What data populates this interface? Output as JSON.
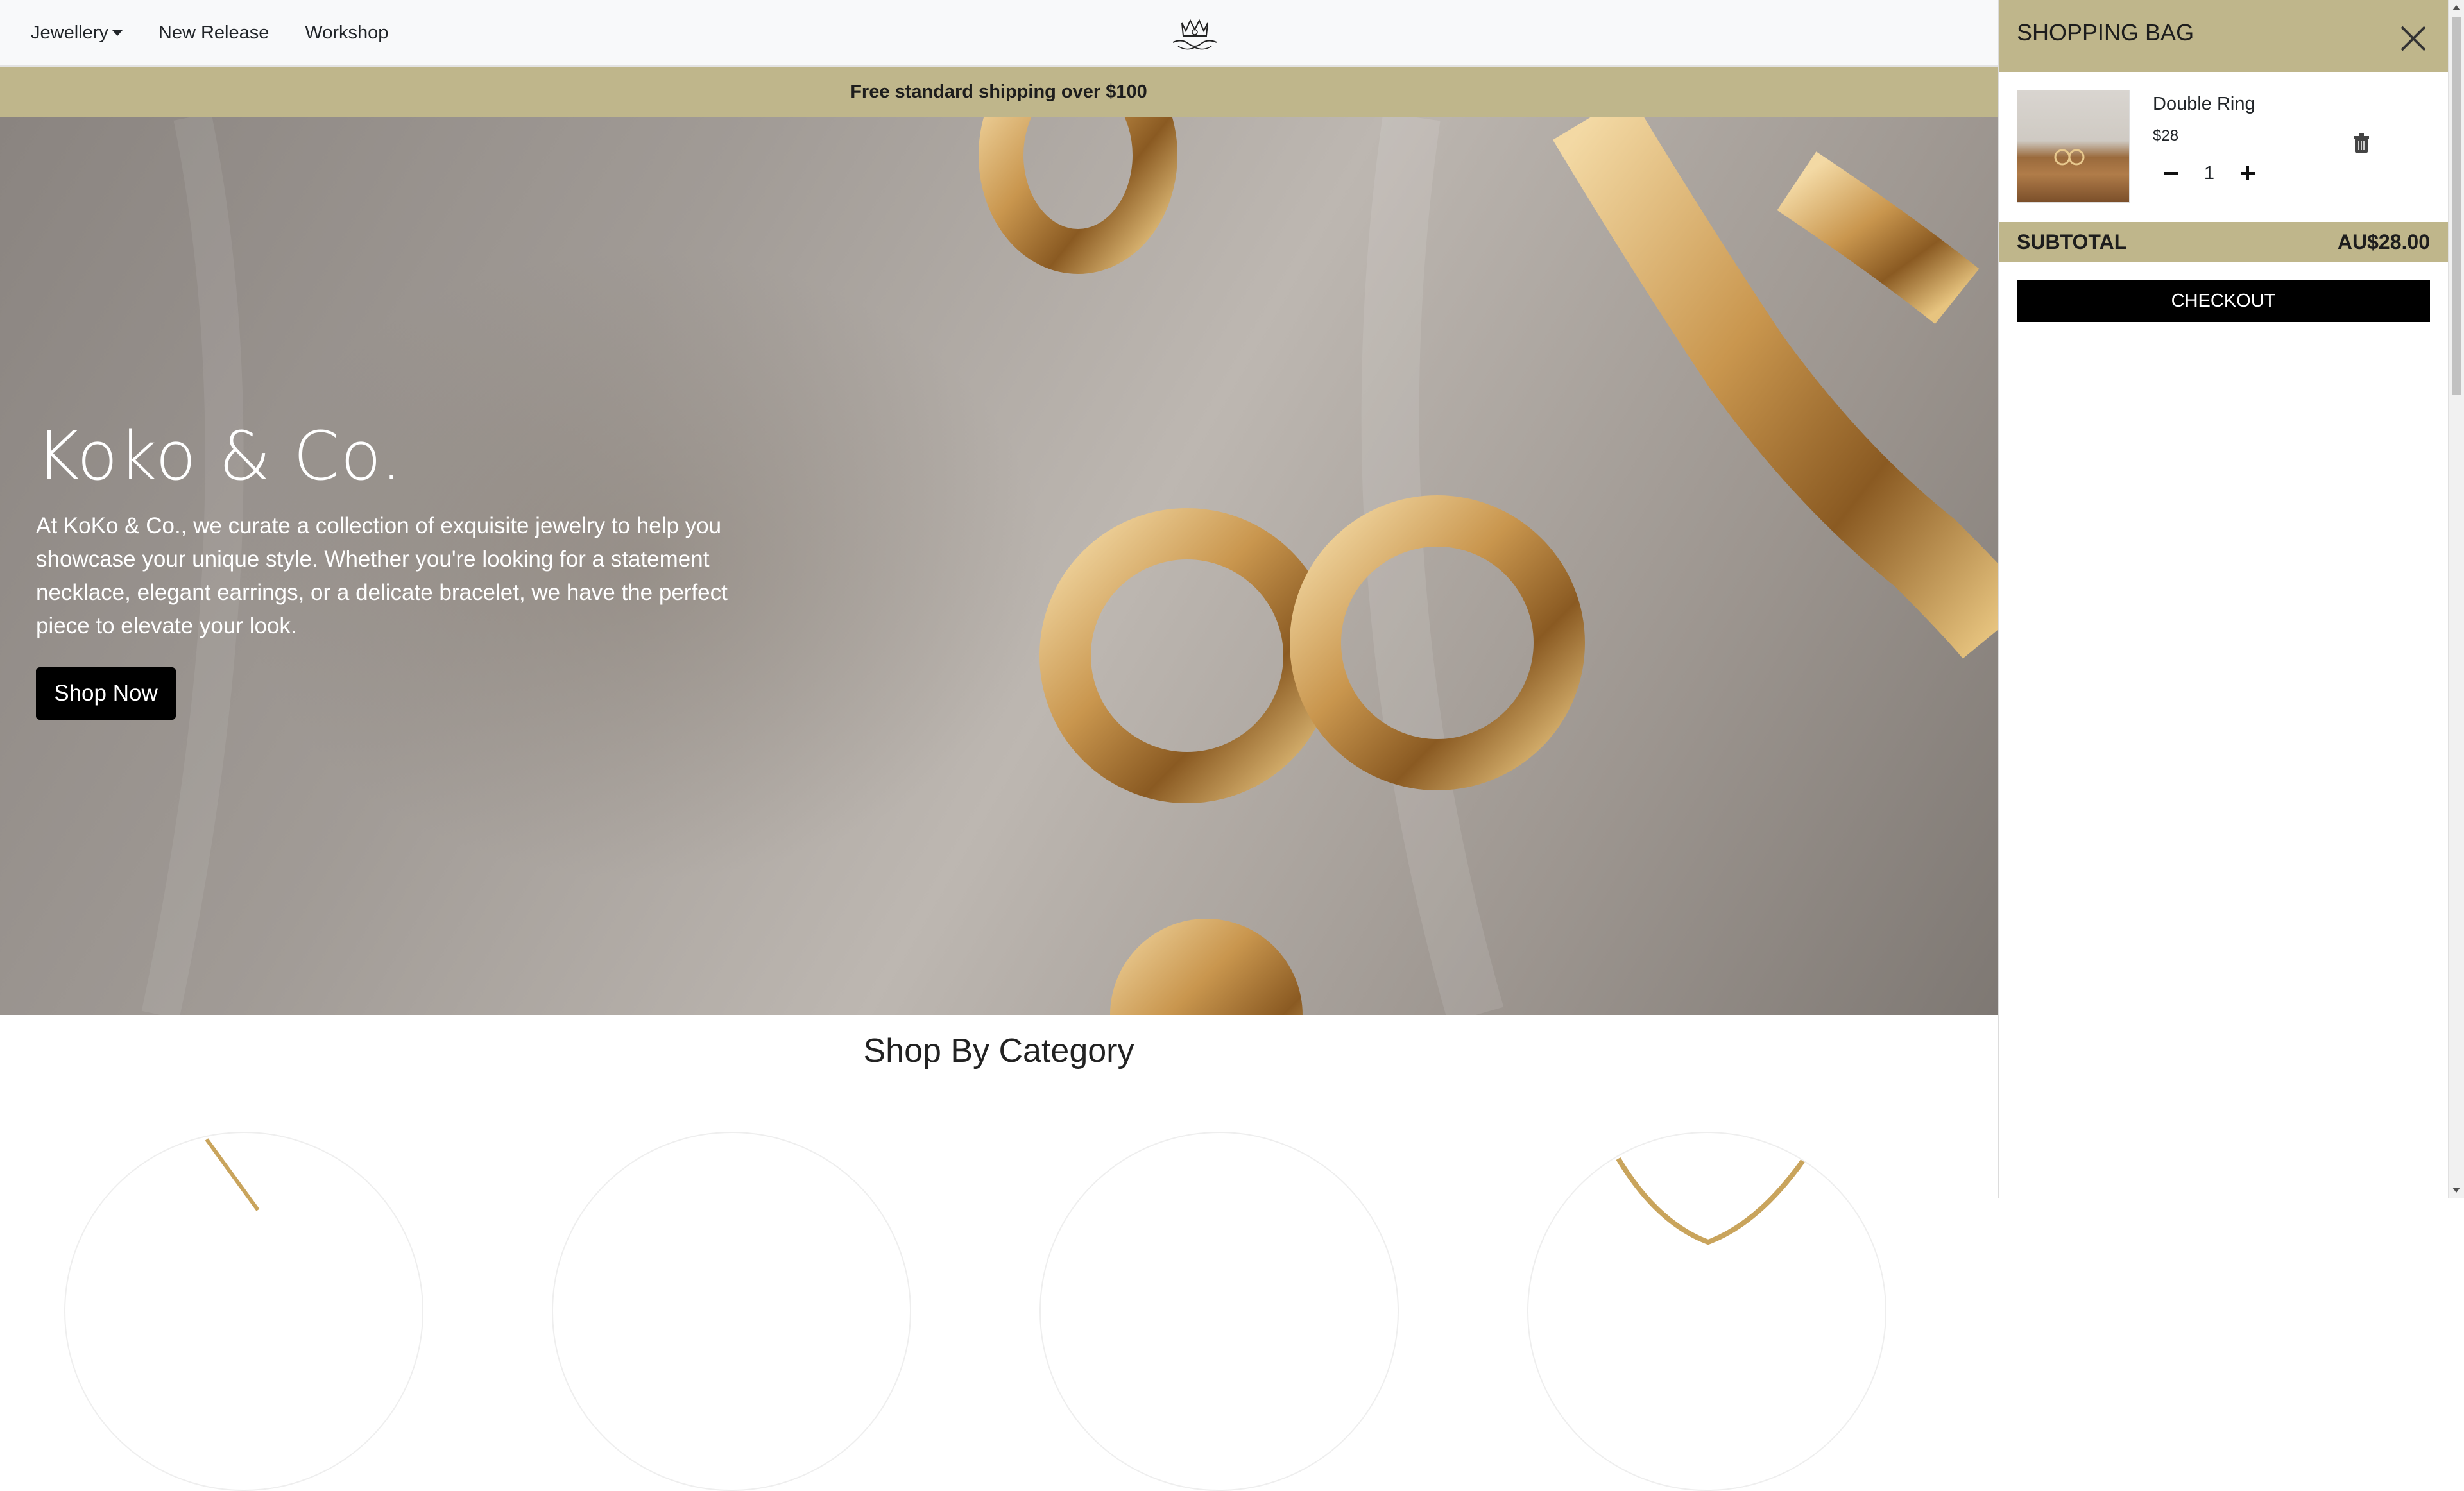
{
  "navbar": {
    "items": [
      {
        "label": "Jewellery",
        "has_dropdown": true
      },
      {
        "label": "New Release"
      },
      {
        "label": "Workshop"
      }
    ],
    "logo_icon": "crown-logo-icon"
  },
  "banner": {
    "text": "Free standard shipping over $100"
  },
  "hero": {
    "title": "Koko & Co.",
    "description": "At KoKo & Co., we curate a collection of exquisite jewelry to help you showcase your unique style. Whether you're looking for a statement necklace, elegant earrings, or a delicate bracelet, we have the perfect piece to elevate your look.",
    "button_label": "Shop Now"
  },
  "categories": {
    "title": "Shop By Category"
  },
  "cart": {
    "title": "SHOPPING BAG",
    "items": [
      {
        "name": "Double Ring",
        "price": "$28",
        "quantity": "1"
      }
    ],
    "subtotal_label": "SUBTOTAL",
    "subtotal_value": "AU$28.00",
    "checkout_label": "CHECKOUT"
  },
  "colors": {
    "accent": "#bfb68b",
    "button": "#000000",
    "navbar_bg": "#f8f9fa"
  }
}
